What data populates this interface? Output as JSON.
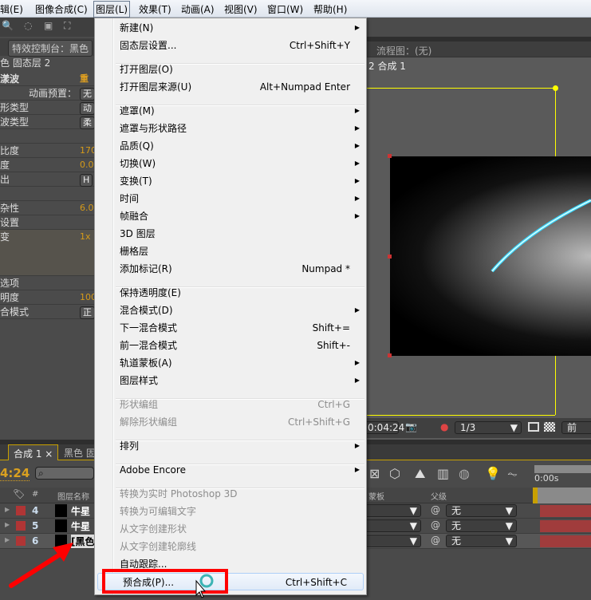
{
  "menubar": {
    "items": [
      "辑(E)",
      "图像合成(C)",
      "图层(L)",
      "效果(T)",
      "动画(A)",
      "视图(V)",
      "窗口(W)",
      "帮助(H)"
    ]
  },
  "left_panel": {
    "tab": "特效控制台：黑色",
    "layer": "色 固态层 2",
    "effect": "漾波",
    "reset": "重置",
    "rows": [
      {
        "label": "动画预置：",
        "value": "无"
      },
      {
        "label": "形类型",
        "value": "动"
      },
      {
        "label": "波类型",
        "value": "柔"
      },
      {
        "label": "",
        "value": ""
      },
      {
        "label": "比度",
        "value": "170"
      },
      {
        "label": "度",
        "value": "0.0"
      },
      {
        "label": "出",
        "value": "H"
      },
      {
        "label": "",
        "value": ""
      },
      {
        "label": "杂性",
        "value": "6.0"
      },
      {
        "label": "设置",
        "value": ""
      },
      {
        "label": "变",
        "value": "1x"
      },
      {
        "label": "选项",
        "value": ""
      },
      {
        "label": "明度",
        "value": "100"
      },
      {
        "label": "合模式",
        "value": "正"
      }
    ]
  },
  "viewer": {
    "flowchart": "流程图：(无)",
    "comp_label": "2 合成 1",
    "timecode": "0:04:24",
    "resolution": "1/3",
    "view": "前"
  },
  "timeline": {
    "tab1": "合成 1",
    "tab2": "黑色 固",
    "time": "4:24",
    "ruler": "0:00s",
    "col_hash": "#",
    "col_name": "图层名称",
    "col_matte": "蒙板",
    "col_parent": "父级",
    "layers": [
      {
        "num": "4",
        "name": "牛星",
        "parent": "无"
      },
      {
        "num": "5",
        "name": "牛星",
        "parent": "无"
      },
      {
        "num": "6",
        "name": "[黑色",
        "parent": "无"
      }
    ],
    "label_color": "#b03535"
  },
  "menu": {
    "items": [
      {
        "label": "新建(N)",
        "sub": true
      },
      {
        "label": "固态层设置...",
        "shortcut": "Ctrl+Shift+Y"
      },
      {
        "label": "打开图层(O)"
      },
      {
        "label": "打开图层来源(U)",
        "shortcut": "Alt+Numpad Enter"
      },
      {
        "label": "遮罩(M)",
        "sub": true
      },
      {
        "label": "遮罩与形状路径",
        "sub": true
      },
      {
        "label": "品质(Q)",
        "sub": true
      },
      {
        "label": "切换(W)",
        "sub": true
      },
      {
        "label": "变换(T)",
        "sub": true
      },
      {
        "label": "时间",
        "sub": true
      },
      {
        "label": "帧融合",
        "sub": true
      },
      {
        "label": "3D 图层"
      },
      {
        "label": "栅格层"
      },
      {
        "label": "添加标记(R)",
        "shortcut": "Numpad *"
      },
      {
        "label": "保持透明度(E)"
      },
      {
        "label": "混合模式(D)",
        "sub": true
      },
      {
        "label": "下一混合模式",
        "shortcut": "Shift+="
      },
      {
        "label": "前一混合模式",
        "shortcut": "Shift+-"
      },
      {
        "label": "轨道蒙板(A)",
        "sub": true
      },
      {
        "label": "图层样式",
        "sub": true
      },
      {
        "label": "形状编组",
        "shortcut": "Ctrl+G",
        "disabled": true
      },
      {
        "label": "解除形状编组",
        "shortcut": "Ctrl+Shift+G",
        "disabled": true
      },
      {
        "label": "排列",
        "sub": true
      },
      {
        "label": "Adobe Encore",
        "sub": true
      },
      {
        "label": "转换为实时 Photoshop 3D",
        "disabled": true
      },
      {
        "label": "转换为可编辑文字",
        "disabled": true
      },
      {
        "label": "从文字创建形状",
        "disabled": true
      },
      {
        "label": "从文字创建轮廓线",
        "disabled": true
      },
      {
        "label": "自动跟踪..."
      },
      {
        "label": "预合成(P)...",
        "shortcut": "Ctrl+Shift+C",
        "highlighted": true
      }
    ]
  }
}
